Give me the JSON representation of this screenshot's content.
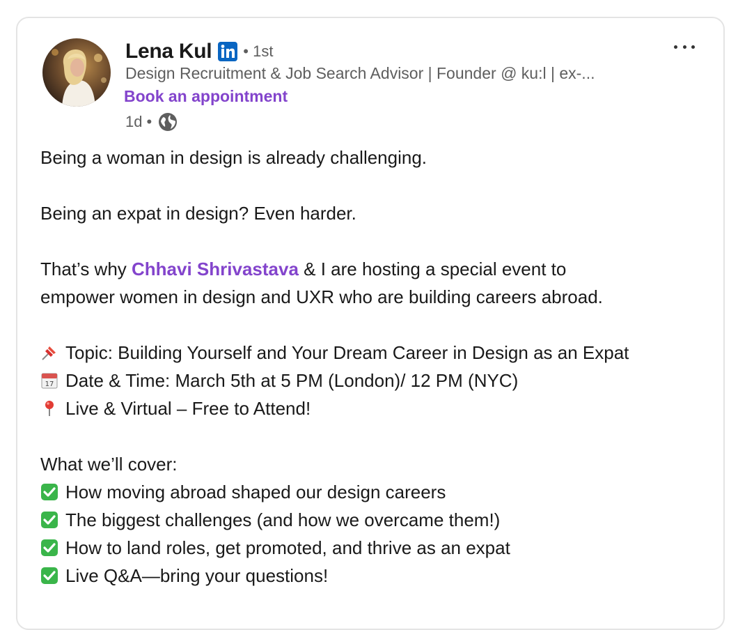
{
  "author": {
    "name": "Lena Kul",
    "degree": "1st",
    "headline": "Design Recruitment & Job Search Advisor | Founder @ ku:l | ex-...",
    "cta": "Book an appointment",
    "time_ago": "1d",
    "separator": "•",
    "badge_icon": "linkedin-icon",
    "visibility_icon": "globe-icon"
  },
  "menu": {
    "icon": "more-options-icon"
  },
  "post": {
    "p1": "Being a woman in design is already challenging.",
    "p2": "Being an expat in design? Even harder.",
    "p3_before": "That’s why ",
    "p3_mention": "Chhavi Shrivastava",
    "p3_after": " & I are hosting a special event to",
    "p3_line2": "empower women in design and UXR who are building careers abroad.",
    "topic": "Topic: Building Yourself and Your Dream Career in Design as an Expat",
    "datetime": "Date & Time: March 5th at 5 PM (London)/ 12 PM (NYC)",
    "location": "Live & Virtual – Free to Attend!",
    "cover_heading": "What we’ll cover:",
    "cover_items": [
      "How moving abroad shaped our design careers",
      "The biggest challenges (and how we overcame them!)",
      "How to land roles, get promoted, and thrive as an expat",
      "Live Q&A—bring your questions!"
    ],
    "emoji_icons": [
      "pushpin-icon",
      "calendar-icon",
      "round-pushpin-icon",
      "check-mark-button-icon"
    ]
  },
  "colors": {
    "accent": "#8344cc",
    "linkedin_blue": "#0a66c2",
    "check_green": "#3ab54a",
    "text": "#191919",
    "secondary_text": "#5e5e5e"
  }
}
